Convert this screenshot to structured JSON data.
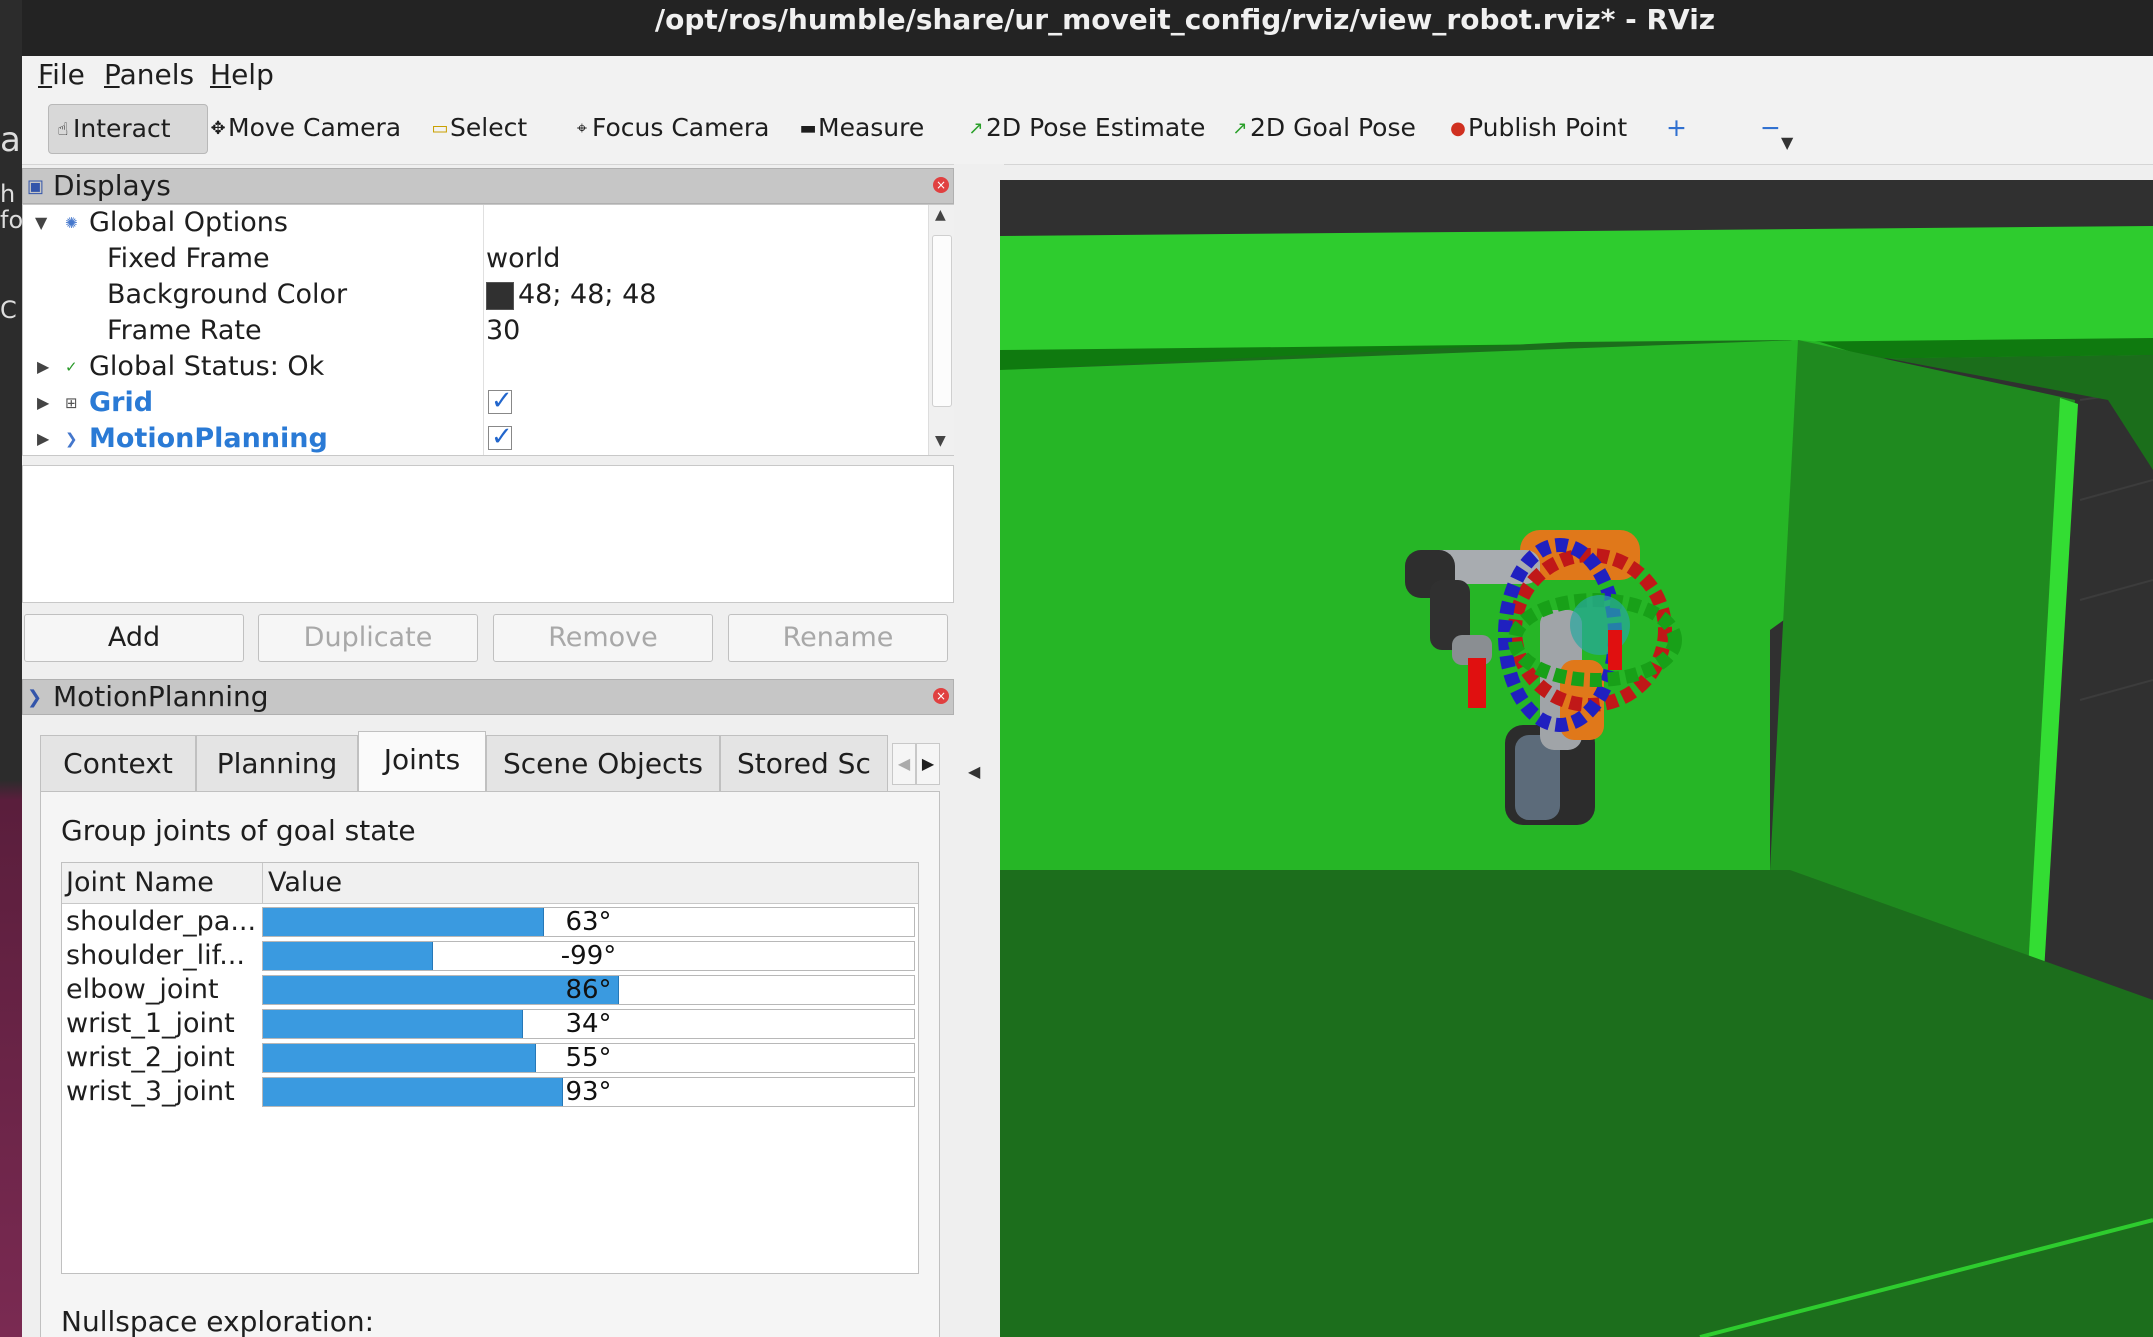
{
  "window": {
    "title": "/opt/ros/humble/share/ur_moveit_config/rviz/view_robot.rviz* - RViz"
  },
  "menu": [
    {
      "first": "F",
      "rest": "ile"
    },
    {
      "first": "P",
      "rest": "anels"
    },
    {
      "first": "H",
      "rest": "elp"
    }
  ],
  "toolbar": {
    "interact": "Interact",
    "move_camera": "Move Camera",
    "select": "Select",
    "focus_camera": "Focus Camera",
    "measure": "Measure",
    "pose_estimate": "2D Pose Estimate",
    "goal_pose": "2D Goal Pose",
    "publish_point": "Publish Point",
    "add_tool_icon": "plus-icon",
    "remove_tool_icon": "minus-icon"
  },
  "displays": {
    "title": "Displays",
    "rows": {
      "global_options": "Global Options",
      "fixed_frame": {
        "name": "Fixed Frame",
        "value": "world"
      },
      "background_color": {
        "name": "Background Color",
        "value": "48; 48; 48",
        "swatch": "#303030"
      },
      "frame_rate": {
        "name": "Frame Rate",
        "value": "30"
      },
      "global_status": "Global Status: Ok",
      "grid": "Grid",
      "motion_planning": "MotionPlanning"
    },
    "buttons": {
      "add": "Add",
      "duplicate": "Duplicate",
      "remove": "Remove",
      "rename": "Rename"
    }
  },
  "motion_planning": {
    "title": "MotionPlanning",
    "tabs": [
      "Context",
      "Planning",
      "Joints",
      "Scene Objects",
      "Stored Sc"
    ],
    "active_tab": "Joints",
    "group_label": "Group joints of goal state",
    "table": {
      "headers": [
        "Joint Name",
        "Value"
      ],
      "rows": [
        {
          "name": "shoulder_pa...",
          "value": "63°",
          "fill": 0.43
        },
        {
          "name": "shoulder_lif...",
          "value": "-99°",
          "fill": 0.26
        },
        {
          "name": "elbow_joint",
          "value": "86°",
          "fill": 0.545
        },
        {
          "name": "wrist_1_joint",
          "value": "34°",
          "fill": 0.398
        },
        {
          "name": "wrist_2_joint",
          "value": "55°",
          "fill": 0.418
        },
        {
          "name": "wrist_3_joint",
          "value": "93°",
          "fill": 0.46
        }
      ]
    },
    "nullspace_label": "Nullspace exploration:"
  },
  "viewport": {
    "background": "#303030",
    "obstacle_color": "#2ecc2e"
  },
  "desktop": {
    "fragments": [
      "al",
      "h",
      "fo",
      "C"
    ]
  }
}
